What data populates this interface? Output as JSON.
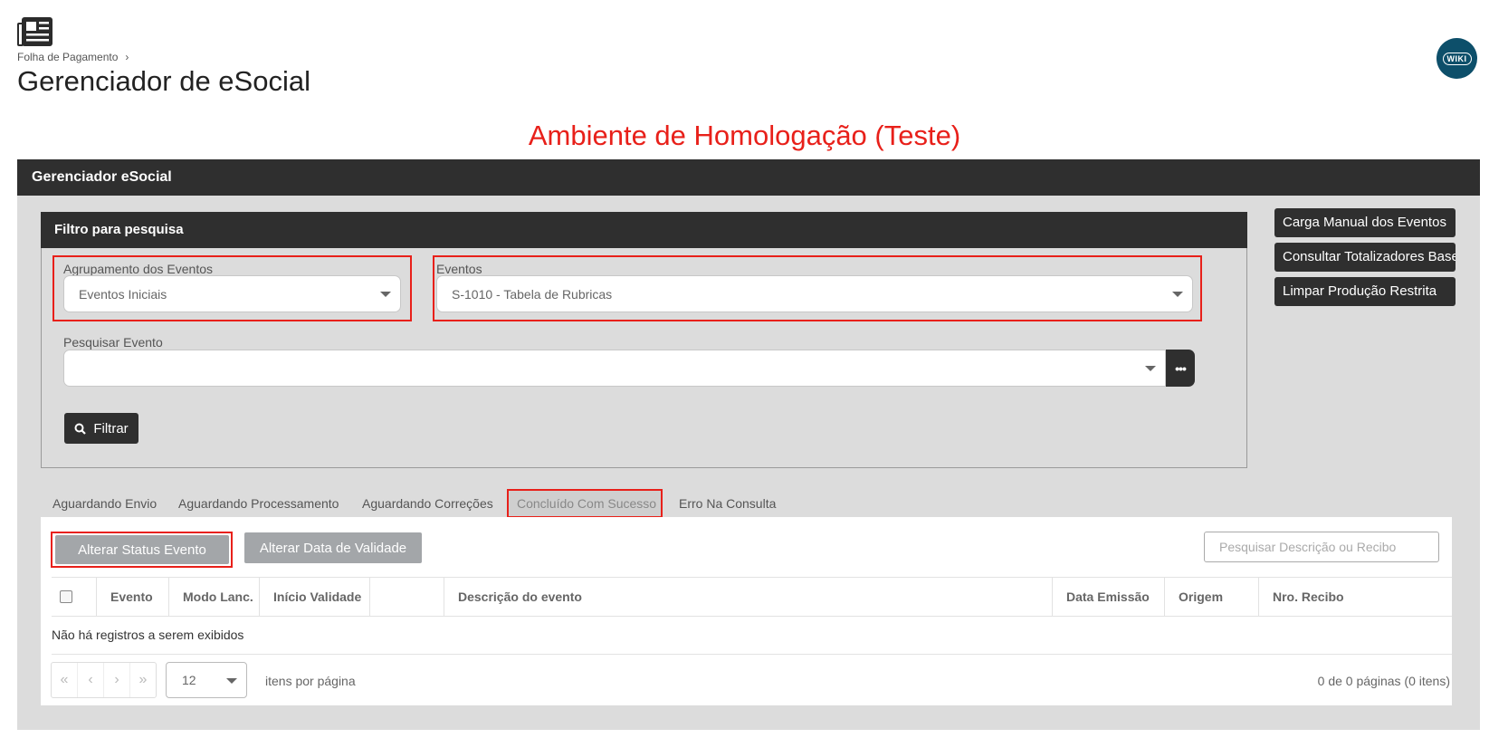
{
  "header": {
    "breadcrumb": "Folha de Pagamento",
    "title": "Gerenciador de eSocial",
    "wiki": "WIKI"
  },
  "environment_banner": "Ambiente de Homologação (Teste)",
  "panel": {
    "title": "Gerenciador eSocial"
  },
  "filter": {
    "title": "Filtro para pesquisa",
    "grouping_label": "Agrupamento dos Eventos",
    "grouping_value": "Eventos Iniciais",
    "events_label": "Eventos",
    "events_value": "S-1010 - Tabela de Rubricas",
    "search_label": "Pesquisar Evento",
    "search_value": "",
    "filter_button": "Filtrar"
  },
  "side_buttons": [
    "Carga Manual dos Eventos",
    "Consultar Totalizadores Base",
    "Limpar Produção Restrita"
  ],
  "tabs": [
    {
      "label": "Aguardando Envio",
      "active": false
    },
    {
      "label": "Aguardando Processamento",
      "active": false
    },
    {
      "label": "Aguardando Correções",
      "active": false
    },
    {
      "label": "Concluído Com Sucesso",
      "active": true
    },
    {
      "label": "Erro Na Consulta",
      "active": false
    }
  ],
  "actions": {
    "alter_status": "Alterar Status Evento",
    "alter_validity": "Alterar Data de Validade",
    "search_placeholder": "Pesquisar Descrição ou Recibo"
  },
  "table": {
    "columns": [
      "Evento",
      "Modo Lanc.",
      "Início Validade",
      "",
      "Descrição do evento",
      "Data Emissão",
      "Origem",
      "Nro. Recibo"
    ],
    "empty_message": "Não há registros a serem exibidos"
  },
  "pagination": {
    "page_size": "12",
    "per_page_label": "itens por página",
    "info": "0 de 0 páginas (0 itens)"
  },
  "colors": {
    "dark": "#2f2f2f",
    "highlight": "#e8201a",
    "panel_bg": "#dcdcdc",
    "wiki": "#0d4f6a",
    "gray_button": "#a3a6a9"
  },
  "icons": [
    "newspaper-icon",
    "chevron-right-icon",
    "search-icon",
    "ellipsis-icon",
    "caret-down-icon",
    "first-page-icon",
    "prev-page-icon",
    "next-page-icon",
    "last-page-icon"
  ]
}
